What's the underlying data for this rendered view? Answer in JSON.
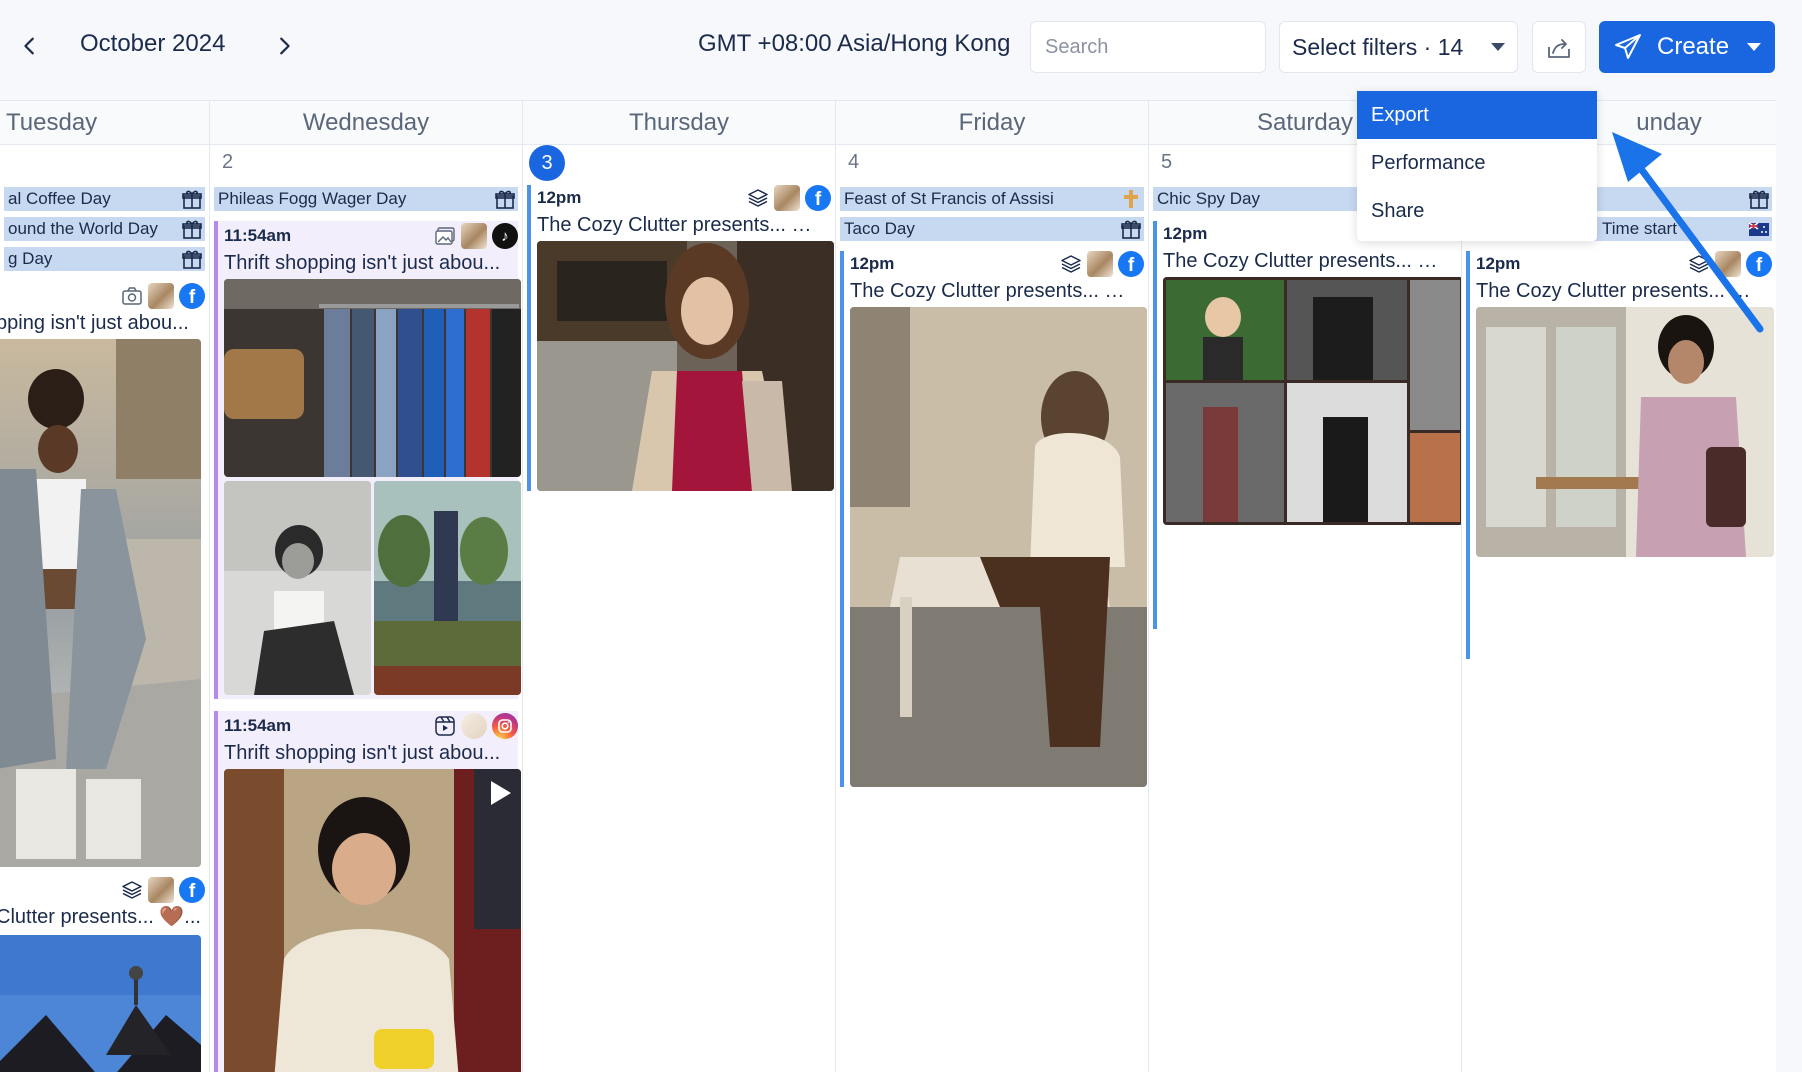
{
  "header": {
    "month": "October 2024",
    "timezone": "GMT +08:00 Asia/Hong Kong",
    "search_placeholder": "Search",
    "filters_label": "Select filters · 14",
    "create_label": "Create"
  },
  "menu": {
    "items": [
      "Export",
      "Performance",
      "Share"
    ]
  },
  "days": {
    "tuesday": {
      "name": "Tuesday",
      "holidays": [
        "al Coffee Day",
        "ound the World Day",
        "g Day"
      ],
      "posts": [
        {
          "title": "pping isn't just abou..."
        },
        {
          "title": "Clutter presents... 🤎..."
        }
      ]
    },
    "wednesday": {
      "name": "Wednesday",
      "number": "2",
      "holidays": [
        "Phileas Fogg Wager Day"
      ],
      "posts": [
        {
          "time": "11:54am",
          "title": "Thrift shopping isn't just abou..."
        },
        {
          "time": "11:54am",
          "title": "Thrift shopping isn't just abou..."
        }
      ]
    },
    "thursday": {
      "name": "Thursday",
      "number": "3",
      "posts": [
        {
          "time": "12pm",
          "title": "The Cozy Clutter presents... 🤎..."
        }
      ]
    },
    "friday": {
      "name": "Friday",
      "number": "4",
      "holidays": [
        "Feast of St Francis of Assisi",
        "Taco Day"
      ],
      "posts": [
        {
          "time": "12pm",
          "title": "The Cozy Clutter presents... 🤎..."
        }
      ]
    },
    "saturday": {
      "name": "Saturday",
      "number": "5",
      "holidays": [
        "Chic Spy Day"
      ],
      "posts": [
        {
          "time": "12pm",
          "title": "The Cozy Clutter presents... 🤎..."
        }
      ]
    },
    "sunday": {
      "name": "unday",
      "holidays": [
        "",
        "Time start"
      ],
      "posts": [
        {
          "time": "12pm",
          "title": "The Cozy Clutter presents... 🤎..."
        }
      ]
    }
  },
  "colors": {
    "accent": "#1a66e0",
    "holiday_bg": "#c7d8f1",
    "fb_bar": "#4b93e8",
    "ig_bar": "#b58be8",
    "annotation_arrow": "#1a73e8"
  }
}
